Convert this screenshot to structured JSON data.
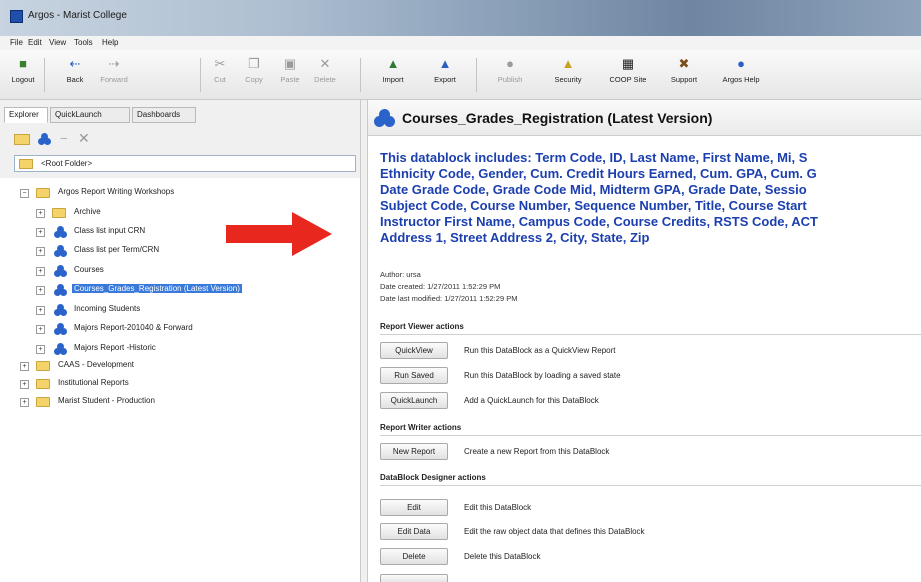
{
  "window": {
    "title": "Argos - Marist College"
  },
  "menu": [
    "File",
    "Edit",
    "View",
    "Tools",
    "Help"
  ],
  "toolbar": {
    "logout": "Logout",
    "back": "Back",
    "forward": "Forward",
    "cut": "Cut",
    "copy": "Copy",
    "paste": "Paste",
    "delete": "Delete",
    "import": "Import",
    "export": "Export",
    "publish": "Publish",
    "security": "Security",
    "coop": "COOP Site",
    "support": "Support",
    "help": "Argos Help"
  },
  "tabs": [
    "Explorer",
    "QuickLaunch",
    "Dashboards"
  ],
  "root_folder": "<Root Folder>",
  "tree": {
    "workshops": "Argos Report Writing Workshops",
    "archive": "Archive",
    "class_list_crn": "Class list input CRN",
    "class_list_term": "Class list per Term/CRN",
    "courses": "Courses",
    "courses_grades": "Courses_Grades_Registration (Latest Version)",
    "incoming": "Incoming Students",
    "majors_forward": "Majors Report-201040 & Forward",
    "majors_historic": "Majors Report -Historic",
    "caas": "CAAS - Development",
    "institutional": "Institutional Reports",
    "marist": "Marist Student - Production"
  },
  "panel": {
    "title": "Courses_Grades_Registration (Latest Version)",
    "description": [
      "This datablock includes: Term Code, ID, Last Name, First Name, Mi, S",
      "Ethnicity Code,  Gender, Cum. Credit Hours Earned, Cum. GPA,  Cum. G",
      "Date Grade Code, Grade Code Mid, Midterm GPA, Grade Date, Sessio",
      "Subject Code, Course Number, Sequence Number, Title,  Course Start",
      "Instructor First Name, Campus Code, Course Credits,  RSTS Code, ACT",
      "Address 1, Street Address 2, City, State, Zip"
    ],
    "author": "Author: ursa",
    "created": "Date created: 1/27/2011 1:52:29 PM",
    "modified": "Date last modified: 1/27/2011 1:52:29 PM"
  },
  "viewer": {
    "heading": "Report Viewer actions",
    "quickview": "QuickView",
    "quickview_desc": "Run this DataBlock as a QuickView Report",
    "runsaved": "Run Saved",
    "runsaved_desc": "Run this DataBlock by loading a saved state",
    "quicklaunch": "QuickLaunch",
    "quicklaunch_desc": "Add a QuickLaunch for this DataBlock"
  },
  "writer": {
    "heading": "Report Writer actions",
    "newreport": "New Report",
    "newreport_desc": "Create a new Report from this DataBlock"
  },
  "designer": {
    "heading": "DataBlock Designer actions",
    "edit": "Edit",
    "edit_desc": "Edit this DataBlock",
    "editdata": "Edit Data",
    "editdata_desc": "Edit the raw object data that defines this DataBlock",
    "delete": "Delete",
    "delete_desc": "Delete this DataBlock"
  },
  "colors": {
    "accent": "#1b3fae",
    "selection": "#3879d9",
    "arrow": "#e8281e"
  }
}
